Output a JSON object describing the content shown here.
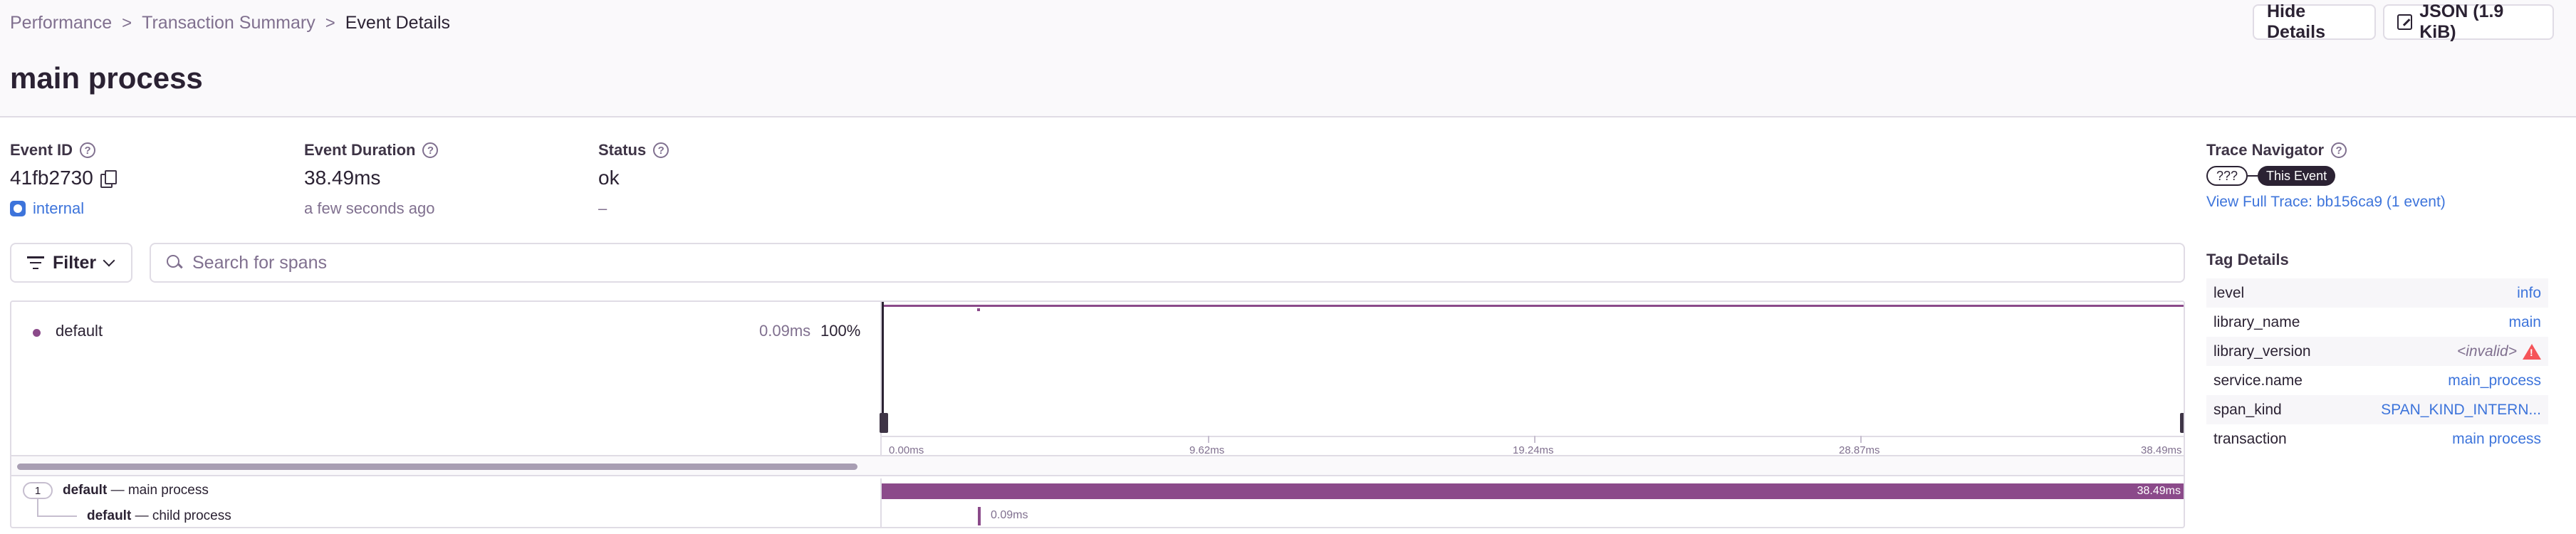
{
  "breadcrumbs": {
    "items": [
      "Performance",
      "Transaction Summary"
    ],
    "current": "Event Details",
    "separator": ">"
  },
  "page": {
    "title": "main process"
  },
  "actions": {
    "hide_details": "Hide Details",
    "json": "JSON (1.9 KiB)"
  },
  "event": {
    "id_label": "Event ID",
    "id": "41fb2730",
    "project": "internal",
    "duration_label": "Event Duration",
    "duration": "38.49ms",
    "duration_sub": "a few seconds ago",
    "status_label": "Status",
    "status": "ok",
    "status_sub": "–"
  },
  "toolbar": {
    "filter_label": "Filter",
    "search_placeholder": "Search for spans"
  },
  "minimap": {
    "op_name": "default",
    "op_duration": "0.09ms",
    "op_percent": "100%",
    "ticks": [
      "0.00ms",
      "9.62ms",
      "19.24ms",
      "28.87ms",
      "38.49ms"
    ]
  },
  "spans": [
    {
      "count": "1",
      "op": "default",
      "dash": "—",
      "description": "main process",
      "duration": "38.49ms",
      "start_fraction": 0.0,
      "width_fraction": 1.0
    },
    {
      "op": "default",
      "dash": "—",
      "description": "child process",
      "duration": "0.09ms",
      "start_fraction": 0.073,
      "width_fraction": 0.002
    }
  ],
  "trace_navigator": {
    "label": "Trace Navigator",
    "unknown_pill": "???",
    "this_event_pill": "This Event",
    "view_full_trace": "View Full Trace: bb156ca9 (1 event)"
  },
  "tag_details": {
    "label": "Tag Details",
    "rows": [
      {
        "key": "level",
        "value": "info"
      },
      {
        "key": "library_name",
        "value": "main"
      },
      {
        "key": "library_version",
        "value": "<invalid>"
      },
      {
        "key": "service.name",
        "value": "main_process"
      },
      {
        "key": "span_kind",
        "value": "SPAN_KIND_INTERN..."
      },
      {
        "key": "transaction",
        "value": "main process"
      }
    ]
  },
  "colors": {
    "accent": "#8b4a8a",
    "link": "#3d74db",
    "warning": "#f55459",
    "text": "#2b2233",
    "muted": "#80708f"
  }
}
